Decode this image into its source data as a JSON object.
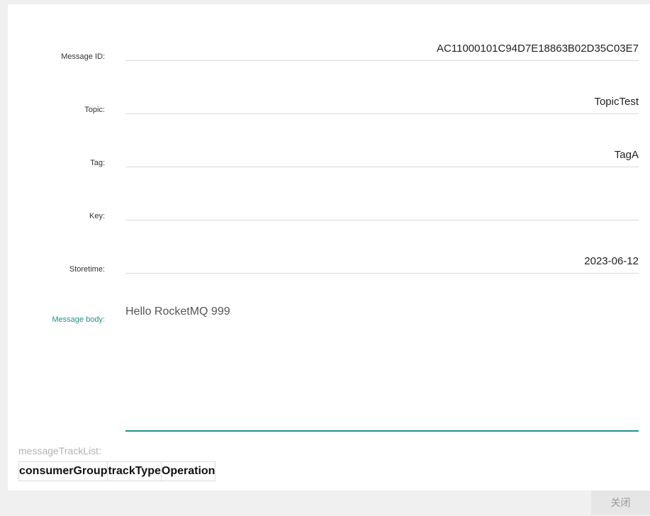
{
  "dialog": {
    "close_glyph": "×",
    "fields": [
      {
        "label": "Message ID:",
        "value": "AC11000101C94D7E18863B02D35C03E7"
      },
      {
        "label": "Topic:",
        "value": "TopicTest"
      },
      {
        "label": "Tag:",
        "value": "TagA"
      },
      {
        "label": "Key:",
        "value": ""
      },
      {
        "label": "Storetime:",
        "value": "2023-06-12"
      }
    ],
    "message_body": {
      "label": "Message body:",
      "value": "Hello RocketMQ 999"
    },
    "track_list": {
      "label": "messageTrackList:",
      "columns": [
        "consumerGroup",
        "trackType",
        "Operation"
      ]
    }
  },
  "footer": {
    "close_button_label": "关闭"
  },
  "colors": {
    "accent": "#1f9488",
    "field_underline": "#d9d9d9",
    "button_bg": "#e6e6e6"
  }
}
